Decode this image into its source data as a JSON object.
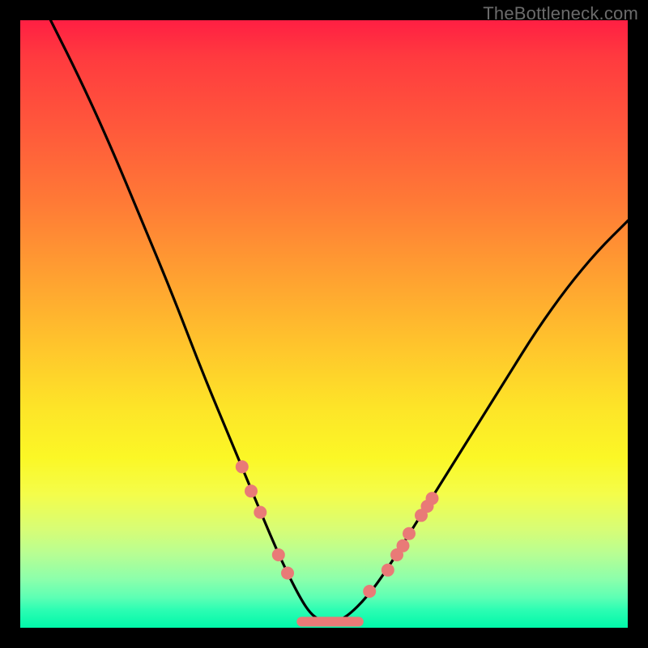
{
  "watermark": "TheBottleneck.com",
  "chart_data": {
    "type": "line",
    "title": "",
    "xlabel": "",
    "ylabel": "",
    "xlim": [
      0,
      100
    ],
    "ylim": [
      0,
      100
    ],
    "series": [
      {
        "name": "bottleneck-curve",
        "x": [
          5,
          10,
          15,
          20,
          25,
          30,
          35,
          40,
          43,
          46,
          48,
          50,
          52,
          54,
          57,
          60,
          65,
          70,
          75,
          80,
          85,
          90,
          95,
          100
        ],
        "y": [
          100,
          90,
          79,
          67,
          55,
          42,
          30,
          18,
          11,
          5,
          2,
          1,
          1,
          2,
          5,
          9,
          17,
          25,
          33,
          41,
          49,
          56,
          62,
          67
        ]
      }
    ],
    "markers": [
      {
        "name": "left-dot-1",
        "x": 36.5,
        "y": 26.5
      },
      {
        "name": "left-dot-2",
        "x": 38.0,
        "y": 22.5
      },
      {
        "name": "left-dot-3",
        "x": 39.5,
        "y": 19.0
      },
      {
        "name": "left-dot-4",
        "x": 42.5,
        "y": 12.0
      },
      {
        "name": "left-dot-5",
        "x": 44.0,
        "y": 9.0
      },
      {
        "name": "right-dot-1",
        "x": 57.5,
        "y": 6.0
      },
      {
        "name": "right-dot-2",
        "x": 60.5,
        "y": 9.5
      },
      {
        "name": "right-dot-3",
        "x": 62.0,
        "y": 12.0
      },
      {
        "name": "right-dot-4",
        "x": 63.0,
        "y": 13.5
      },
      {
        "name": "right-dot-5",
        "x": 64.0,
        "y": 15.5
      },
      {
        "name": "right-dot-6",
        "x": 66.0,
        "y": 18.5
      },
      {
        "name": "right-dot-7",
        "x": 67.0,
        "y": 20.0
      },
      {
        "name": "right-dot-8",
        "x": 67.8,
        "y": 21.3
      }
    ],
    "flat_segment": {
      "name": "valley-bar",
      "x_start": 45.5,
      "x_end": 56.5,
      "y": 1.0
    },
    "colors": {
      "curve": "#000000",
      "markers": "#e97a77",
      "flat_segment": "#e97a77",
      "gradient_top": "#ff1f43",
      "gradient_mid": "#fde528",
      "gradient_bottom": "#00f8a9",
      "frame": "#000000"
    }
  }
}
